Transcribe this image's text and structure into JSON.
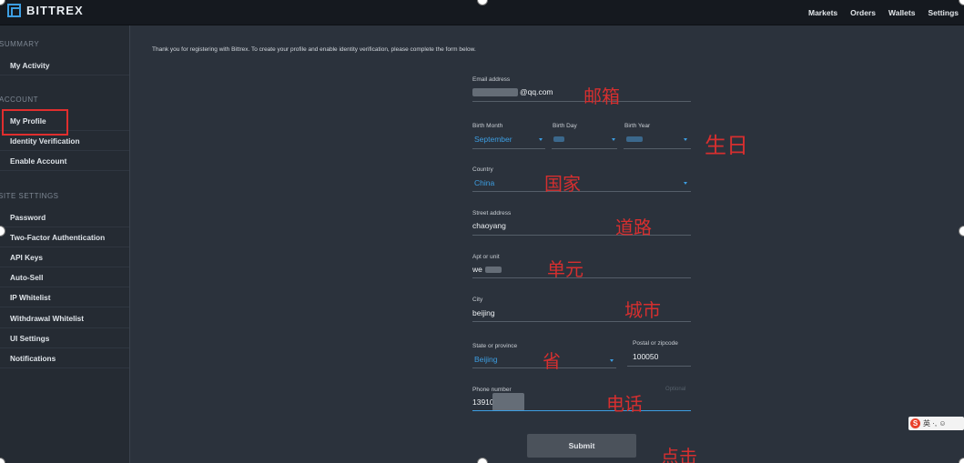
{
  "header": {
    "brand": "BITTREX",
    "nav": [
      "Markets",
      "Orders",
      "Wallets",
      "Settings"
    ]
  },
  "sidebar": {
    "sections": [
      {
        "title": "SUMMARY",
        "items": [
          "My Activity"
        ]
      },
      {
        "title": "ACCOUNT",
        "items": [
          "My Profile",
          "Identity Verification",
          "Enable Account"
        ]
      },
      {
        "title": "SITE SETTINGS",
        "items": [
          "Password",
          "Two-Factor Authentication",
          "API Keys",
          "Auto-Sell",
          "IP Whitelist",
          "Withdrawal Whitelist",
          "UI Settings",
          "Notifications"
        ]
      }
    ],
    "highlighted": "My Profile"
  },
  "notice": "Thank you for registering with Bittrex. To create your profile and enable identity verification, please complete the form below.",
  "form": {
    "email": {
      "label": "Email address",
      "value": "@qq.com"
    },
    "birth_month": {
      "label": "Birth Month",
      "value": "September"
    },
    "birth_day": {
      "label": "Birth Day"
    },
    "birth_year": {
      "label": "Birth Year"
    },
    "country": {
      "label": "Country",
      "value": "China"
    },
    "street": {
      "label": "Street address",
      "value": "chaoyang"
    },
    "apt": {
      "label": "Apt or unit",
      "value": "we"
    },
    "city": {
      "label": "City",
      "value": "beijing"
    },
    "state": {
      "label": "State or province",
      "value": "Beijing"
    },
    "postal": {
      "label": "Postal or zipcode",
      "value": "100050"
    },
    "phone": {
      "label": "Phone number",
      "value": "13910",
      "optional": "Optional"
    },
    "submit": "Submit"
  },
  "annotations": {
    "email": "邮箱",
    "birthday": "生日",
    "country": "国家",
    "street": "道路",
    "unit": "单元",
    "city": "城市",
    "province": "省",
    "phone": "电话",
    "click": "点击"
  },
  "ime": {
    "logo": "S",
    "text": "英 ·, ☺"
  },
  "colors": {
    "accent": "#3d9ee2",
    "annotation": "#d62f2f",
    "background": "#2b323c",
    "topbar": "#15191f"
  }
}
